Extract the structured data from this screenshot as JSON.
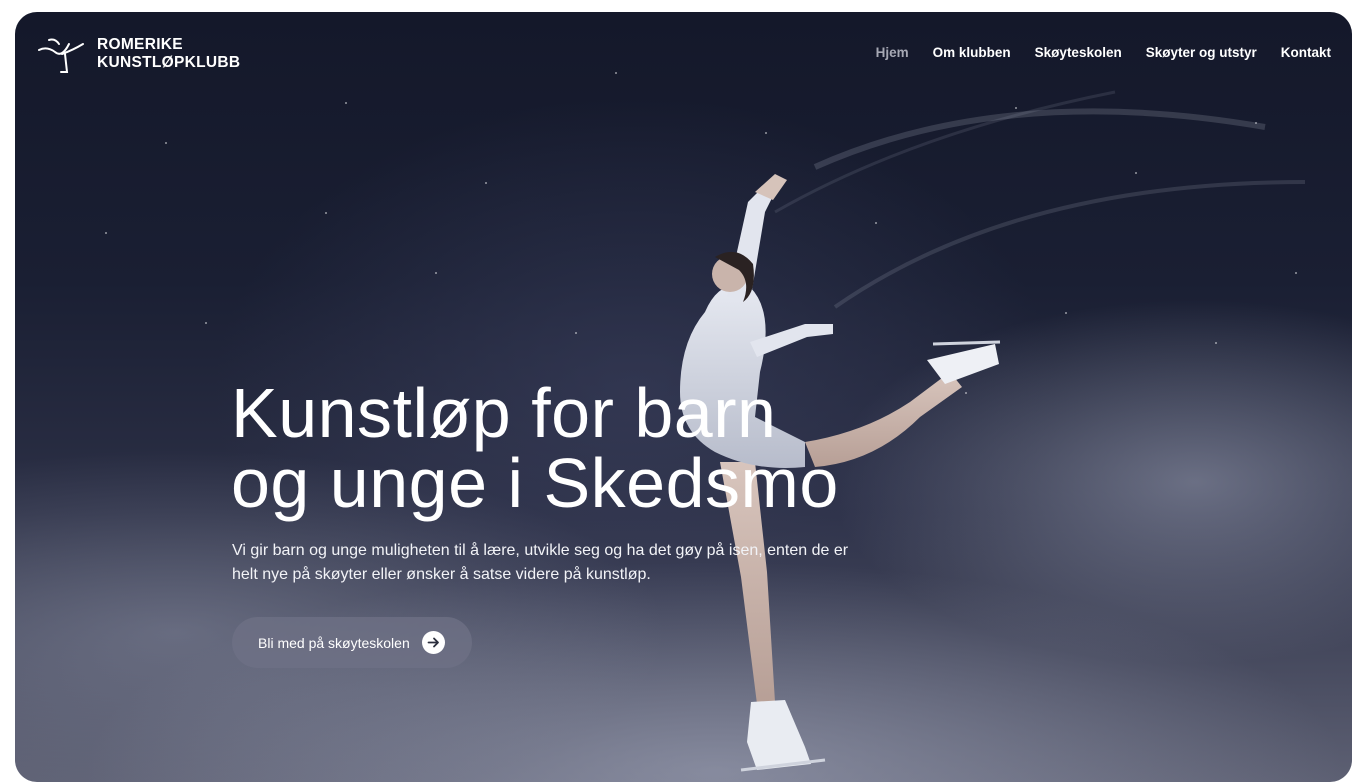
{
  "brand": {
    "line1": "ROMERIKE",
    "line2": "KUNSTLØPKLUBB",
    "logo_icon": "skater-logo-icon"
  },
  "nav": {
    "items": [
      {
        "label": "Hjem",
        "active": true
      },
      {
        "label": "Om klubben",
        "active": false
      },
      {
        "label": "Skøyteskolen",
        "active": false
      },
      {
        "label": "Skøyter og utstyr",
        "active": false
      },
      {
        "label": "Kontakt",
        "active": false
      }
    ]
  },
  "hero": {
    "title_line1": "Kunstløp for barn",
    "title_line2": "og unge i Skedsmo",
    "text_line1": "Vi gir barn og unge muligheten til å lære, utvikle seg og ha det gøy på isen, enten de er",
    "text_line2": "helt nye på skøyter eller ønsker å satse videre på kunstløp.",
    "cta_label": "Bli med på skøyteskolen",
    "cta_icon": "arrow-right-circle-icon"
  },
  "colors": {
    "background_dark": "#14182a",
    "nav_active": "#a6a8b4",
    "cta_bg": "#6e7185",
    "text": "#ffffff"
  }
}
